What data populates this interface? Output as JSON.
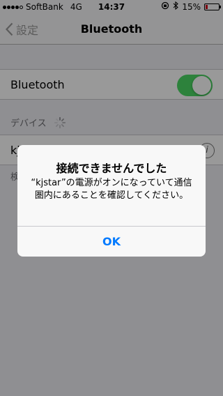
{
  "status_bar": {
    "carrier": "SoftBank",
    "network": "4G",
    "time": "14:37",
    "battery_percent": "15%",
    "battery_level": 0.15,
    "battery_color": "#d0021b"
  },
  "nav": {
    "back_label": "設定",
    "title": "Bluetooth"
  },
  "bluetooth_row": {
    "label": "Bluetooth",
    "enabled": true,
    "toggle_color": "#4cd964"
  },
  "devices_section": {
    "header": "デバイス",
    "device_name": "kj",
    "footer_partial": "検"
  },
  "alert": {
    "title": "接続できませんでした",
    "message": "“kjstar”の電源がオンになっていて通信圏内にあることを確認してください。",
    "button_label": "OK",
    "button_color": "#007aff"
  }
}
